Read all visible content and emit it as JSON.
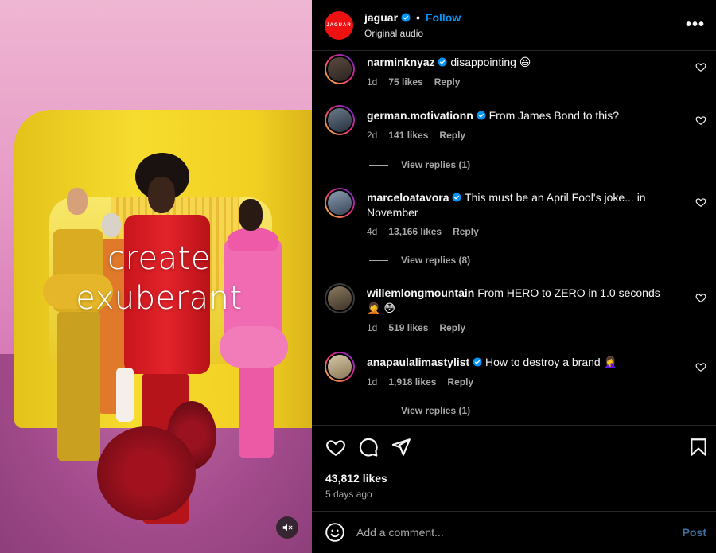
{
  "media": {
    "overlay_text_line1": "create",
    "overlay_text_line2": "exuberant",
    "mute_icon": "speaker-muted-icon"
  },
  "header": {
    "username": "jaguar",
    "avatar_text": "JAGUAR",
    "separator": "•",
    "follow_label": "Follow",
    "audio_label": "Original audio",
    "more_label": "•••"
  },
  "comments": [
    {
      "username": "narminknyaz",
      "verified": true,
      "text": "disappointing 😆",
      "time": "1d",
      "likes": "75 likes",
      "reply": "Reply",
      "view_replies": ""
    },
    {
      "username": "german.motivationn",
      "verified": true,
      "text": "From James Bond to this?",
      "time": "2d",
      "likes": "141 likes",
      "reply": "Reply",
      "view_replies": "View replies (1)"
    },
    {
      "username": "marceloatavora",
      "verified": true,
      "text": "This must be an April Fool's joke... in November",
      "time": "4d",
      "likes": "13,166 likes",
      "reply": "Reply",
      "view_replies": "View replies (8)"
    },
    {
      "username": "willemlongmountain",
      "verified": false,
      "text": "From HERO to ZERO in 1.0 seconds 🤦 😳",
      "time": "1d",
      "likes": "519 likes",
      "reply": "Reply",
      "view_replies": ""
    },
    {
      "username": "anapaulalimastylist",
      "verified": true,
      "text": "How to destroy a brand 🤦‍♀️",
      "time": "1d",
      "likes": "1,918 likes",
      "reply": "Reply",
      "view_replies": "View replies (1)"
    }
  ],
  "actions": {
    "likes_count": "43,812 likes",
    "posted_time": "5 days ago"
  },
  "add_comment": {
    "placeholder": "Add a comment...",
    "post_label": "Post"
  },
  "colors": {
    "accent": "#0095f6",
    "brand_red": "#e11d1d",
    "muted_text": "#a8a8a8"
  }
}
